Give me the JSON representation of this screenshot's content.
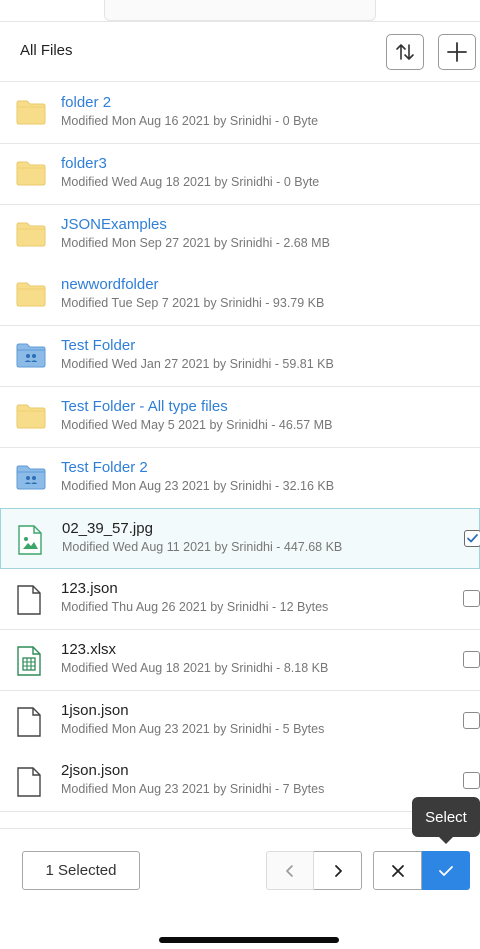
{
  "header": {
    "title": "All Files",
    "sort_icon": "sort-arrows-icon",
    "add_icon": "plus-icon"
  },
  "items": [
    {
      "name": "folder 2",
      "meta": "Modified Mon Aug 16 2021 by Srinidhi - 0 Byte",
      "kind": "folder",
      "icon": "folder-icon"
    },
    {
      "name": "folder3",
      "meta": "Modified Wed Aug 18 2021 by Srinidhi - 0 Byte",
      "kind": "folder",
      "icon": "folder-icon"
    },
    {
      "name": "JSONExamples",
      "meta": "Modified Mon Sep 27 2021 by Srinidhi - 2.68 MB",
      "kind": "folder",
      "icon": "folder-icon"
    },
    {
      "name": "newwordfolder",
      "meta": "Modified Tue Sep 7 2021 by Srinidhi - 93.79 KB",
      "kind": "folder",
      "icon": "folder-icon"
    },
    {
      "name": "Test Folder",
      "meta": "Modified Wed Jan 27 2021 by Srinidhi - 59.81 KB",
      "kind": "shared-folder",
      "icon": "shared-folder-icon"
    },
    {
      "name": "Test Folder - All type files",
      "meta": "Modified Wed May 5 2021 by Srinidhi - 46.57 MB",
      "kind": "folder",
      "icon": "folder-icon"
    },
    {
      "name": "Test Folder 2",
      "meta": "Modified Mon Aug 23 2021 by Srinidhi - 32.16 KB",
      "kind": "shared-folder",
      "icon": "shared-folder-icon"
    },
    {
      "name": "02_39_57.jpg",
      "meta": "Modified Wed Aug 11 2021 by Srinidhi - 447.68 KB",
      "kind": "image",
      "icon": "image-file-icon",
      "checked": true
    },
    {
      "name": "123.json",
      "meta": "Modified Thu Aug 26 2021 by Srinidhi - 12 Bytes",
      "kind": "file",
      "icon": "document-icon",
      "checked": false
    },
    {
      "name": "123.xlsx",
      "meta": "Modified Wed Aug 18 2021 by Srinidhi - 8.18 KB",
      "kind": "sheet",
      "icon": "spreadsheet-icon",
      "checked": false
    },
    {
      "name": "1json.json",
      "meta": "Modified Mon Aug 23 2021 by Srinidhi - 5 Bytes",
      "kind": "file",
      "icon": "document-icon",
      "checked": false
    },
    {
      "name": "2json.json",
      "meta": "Modified Mon Aug 23 2021 by Srinidhi - 7 Bytes",
      "kind": "file",
      "icon": "document-icon",
      "checked": false
    }
  ],
  "footer": {
    "selected_label": "1 Selected",
    "prev_icon": "chevron-left-icon",
    "next_icon": "chevron-right-icon",
    "cancel_icon": "close-icon",
    "confirm_icon": "check-icon"
  },
  "tooltip": {
    "text": "Select"
  },
  "colors": {
    "link": "#2f7fd6",
    "folder": "#f7dd8a",
    "shared_folder": "#6fa9e0",
    "accent": "#2d86e3",
    "selected_row_bg": "#f3fafb",
    "selected_row_border": "#9fd3de"
  }
}
